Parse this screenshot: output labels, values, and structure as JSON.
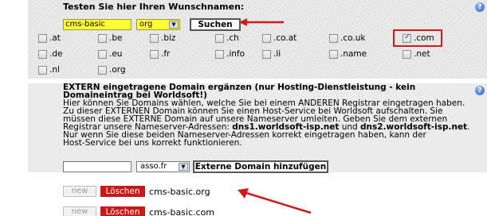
{
  "search": {
    "title": "Testen Sie hier Ihren Wunschnamen:",
    "name_value": "cms-basic",
    "tld_selected": "org",
    "submit_label": "Suchen"
  },
  "tlds": [
    {
      "label": ".at",
      "checked": false
    },
    {
      "label": ".be",
      "checked": false
    },
    {
      "label": ".biz",
      "checked": false
    },
    {
      "label": ".ch",
      "checked": false
    },
    {
      "label": ".co.at",
      "checked": false
    },
    {
      "label": ".co.uk",
      "checked": false
    },
    {
      "label": ".com",
      "checked": true
    },
    {
      "label": ".de",
      "checked": false
    },
    {
      "label": ".eu",
      "checked": false
    },
    {
      "label": ".fr",
      "checked": false
    },
    {
      "label": ".info",
      "checked": false
    },
    {
      "label": ".li",
      "checked": false
    },
    {
      "label": ".name",
      "checked": false
    },
    {
      "label": ".net",
      "checked": false
    },
    {
      "label": ".nl",
      "checked": false
    },
    {
      "label": ".org",
      "checked": false
    }
  ],
  "external": {
    "heading_line1": "EXTERN eingetragene Domain ergänzen (nur Hosting-Dienstleistung - kein",
    "heading_line2": "Domaineintrag bei Worldsoft!)",
    "body_1": "Hier können Sie Domains wählen, welche Sie bei einem ANDEREN Registrar eingetragen haben.",
    "body_2": "Zu dieser EXTERNEN Domain können Sie einen Host-Service bei Worldsoft aufschalten. Sie",
    "body_3": "müssen diese EXTERNE Domain auf unsere Nameserver umleiten. Geben Sie dem externen",
    "body_4a": "Registrar unsere Nameserver-Adressen: ",
    "ns1": "dns1.worldsoft-isp.net",
    "body_4b": " und ",
    "ns2": "dns2.worldsoft-isp.net",
    "body_4c": ".",
    "body_5": "Nur wenn Sie diese beiden Nameserver-Adressen korrekt eingetragen haben, kann der",
    "body_6": "Host-Service bei uns korrekt funktionieren.",
    "domain_value": "",
    "tld_selected": "asso.fr",
    "submit_label": "Externe Domain hinzufügen"
  },
  "domains": [
    {
      "new_label": "new",
      "delete_label": "Löschen",
      "name": "cms-basic.org"
    },
    {
      "new_label": "new",
      "delete_label": "Löschen",
      "name": "cms-basic.com"
    }
  ],
  "colors": {
    "highlight_yellow": "#ffff33",
    "delete_red": "#c81818",
    "annotation_red": "#d21919"
  },
  "icons": [
    "help-icon",
    "checkbox-icon",
    "dropdown-arrow-icon",
    "annotation-arrow-icon"
  ]
}
